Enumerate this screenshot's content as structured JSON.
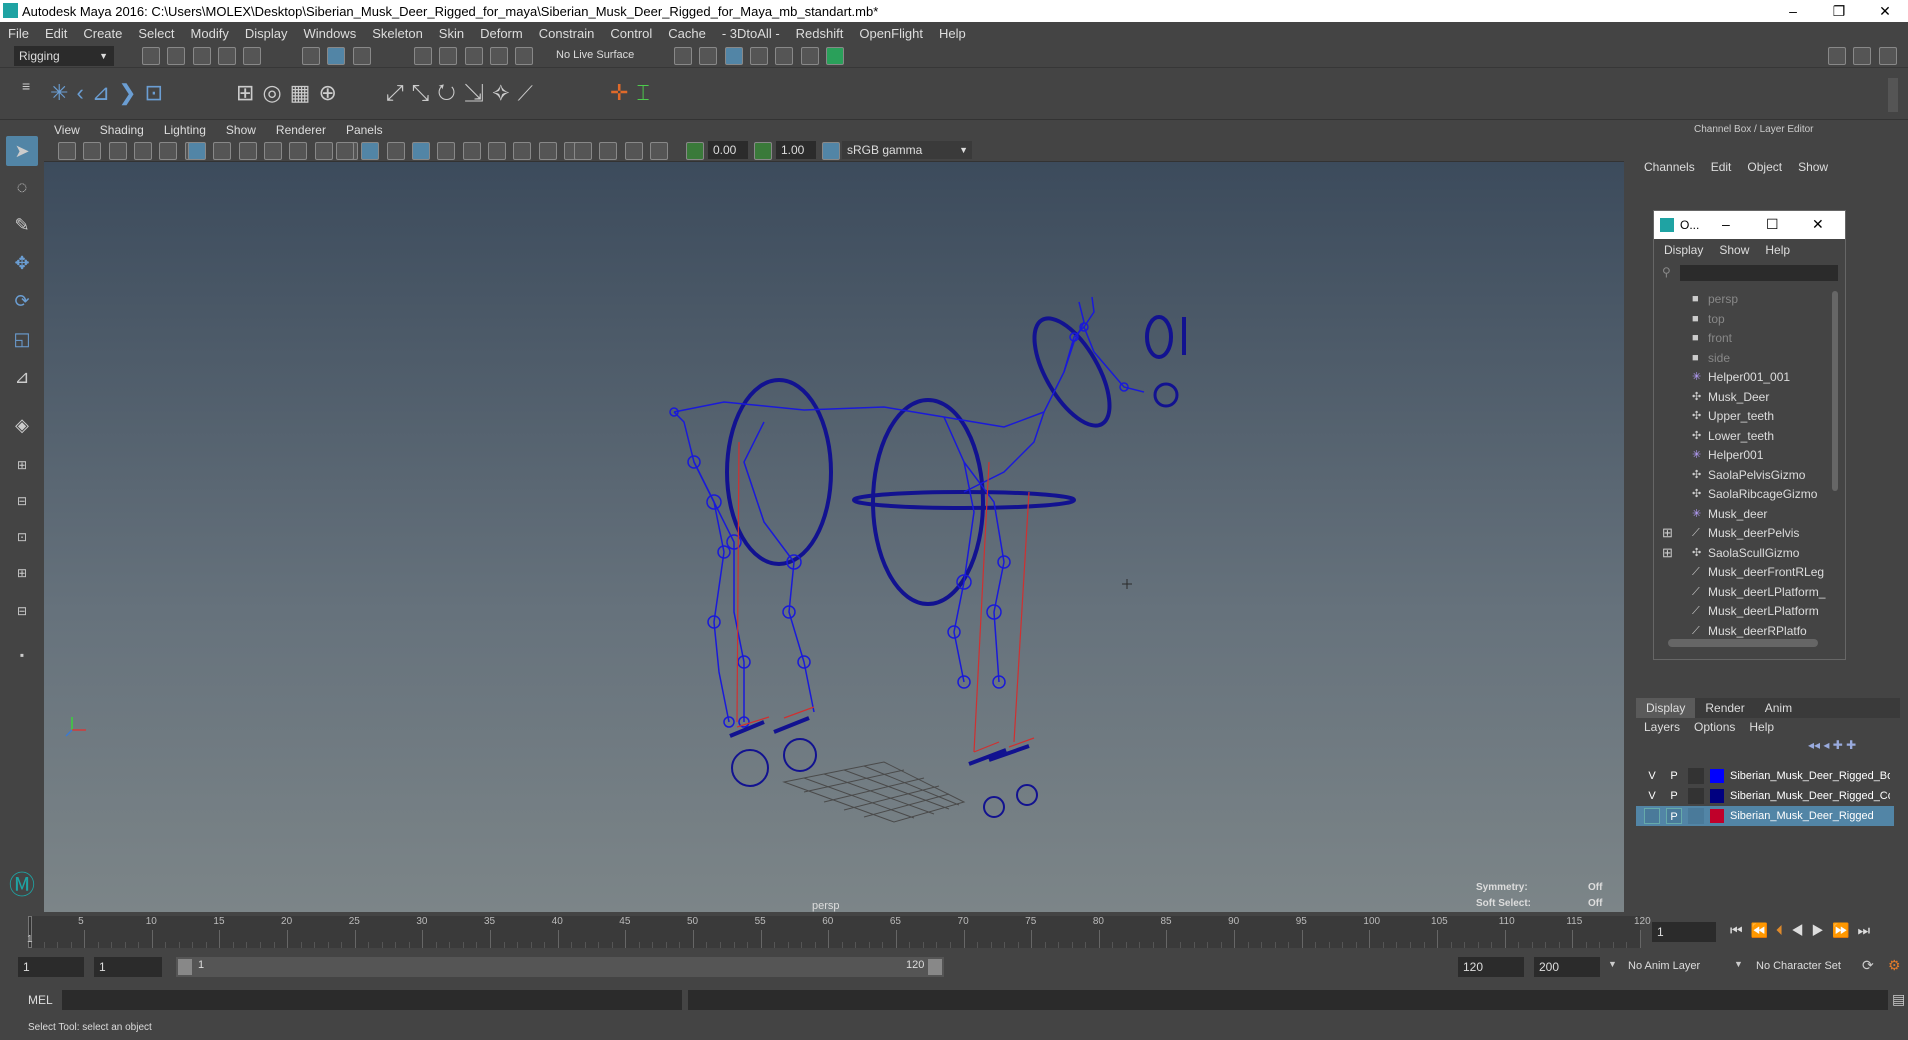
{
  "window": {
    "title": "Autodesk Maya 2016: C:\\Users\\MOLEX\\Desktop\\Siberian_Musk_Deer_Rigged_for_maya\\Siberian_Musk_Deer_Rigged_for_Maya_mb_standart.mb*",
    "minimize": "–",
    "restore": "❐",
    "close": "✕"
  },
  "menubar": [
    "File",
    "Edit",
    "Create",
    "Select",
    "Modify",
    "Display",
    "Windows",
    "Skeleton",
    "Skin",
    "Deform",
    "Constrain",
    "Control",
    "Cache",
    "- 3DtoAll -",
    "Redshift",
    "OpenFlight",
    "Help"
  ],
  "statusline": {
    "menuset": "Rigging",
    "live_surface": "No Live Surface"
  },
  "viewport": {
    "menus": [
      "View",
      "Shading",
      "Lighting",
      "Show",
      "Renderer",
      "Panels"
    ],
    "near_value": "0.00",
    "far_value": "1.00",
    "colorspace": "sRGB gamma",
    "camera_label": "persp",
    "symmetry_label": "Symmetry:",
    "symmetry_value": "Off",
    "soft_select_label": "Soft Select:",
    "soft_select_value": "Off"
  },
  "channelbox": {
    "header": "Channel Box / Layer Editor",
    "menus": [
      "Channels",
      "Edit",
      "Object",
      "Show"
    ]
  },
  "outliner": {
    "title": "O...",
    "menus": [
      "Display",
      "Show",
      "Help"
    ],
    "items": [
      {
        "label": "persp",
        "kind": "camera"
      },
      {
        "label": "top",
        "kind": "camera"
      },
      {
        "label": "front",
        "kind": "camera"
      },
      {
        "label": "side",
        "kind": "camera"
      },
      {
        "label": "Helper001_001",
        "kind": "helper"
      },
      {
        "label": "Musk_Deer",
        "kind": "curve"
      },
      {
        "label": "Upper_teeth",
        "kind": "curve"
      },
      {
        "label": "Lower_teeth",
        "kind": "curve"
      },
      {
        "label": "Helper001",
        "kind": "helper"
      },
      {
        "label": "SaolaPelvisGizmo",
        "kind": "curve"
      },
      {
        "label": "SaolaRibcageGizmo",
        "kind": "curve"
      },
      {
        "label": "Musk_deer",
        "kind": "helper"
      },
      {
        "label": "Musk_deerPelvis",
        "kind": "joint"
      },
      {
        "label": "SaolaScullGizmo",
        "kind": "curve"
      },
      {
        "label": "Musk_deerFrontRLeg",
        "kind": "joint"
      },
      {
        "label": "Musk_deerLPlatform_",
        "kind": "joint"
      },
      {
        "label": "Musk_deerLPlatform",
        "kind": "joint"
      },
      {
        "label": "Musk_deerRPlatfo",
        "kind": "joint"
      }
    ]
  },
  "layers": {
    "tabs": [
      "Display",
      "Render",
      "Anim"
    ],
    "menus": [
      "Layers",
      "Options",
      "Help"
    ],
    "rows": [
      {
        "v": "V",
        "p": "P",
        "color": "#0000ff",
        "name": "Siberian_Musk_Deer_Rigged_Bo"
      },
      {
        "v": "V",
        "p": "P",
        "color": "#000080",
        "name": "Siberian_Musk_Deer_Rigged_Co"
      },
      {
        "v": "",
        "p": "P",
        "color": "#c0002a",
        "name": "Siberian_Musk_Deer_Rigged"
      }
    ]
  },
  "timeline": {
    "ticks": [
      "5",
      "10",
      "15",
      "20",
      "25",
      "30",
      "35",
      "40",
      "45",
      "50",
      "55",
      "60",
      "65",
      "70",
      "75",
      "80",
      "85",
      "90",
      "95",
      "100",
      "105",
      "110",
      "115",
      "120"
    ],
    "start_tick": "1",
    "current_frame": "1"
  },
  "range": {
    "start": "1",
    "anim_start": "1",
    "slider_start": "1",
    "slider_end": "120",
    "playback_end": "120",
    "anim_end": "200",
    "anim_layer": "No Anim Layer",
    "character_set": "No Character Set"
  },
  "mel": {
    "label": "MEL"
  },
  "helpline": {
    "text": "Select Tool: select an object"
  },
  "colors": {
    "rig": "#1a1ad9",
    "rig_dark": "#121290",
    "accent": "#5285a6",
    "selected_layer": "#5285a6"
  }
}
